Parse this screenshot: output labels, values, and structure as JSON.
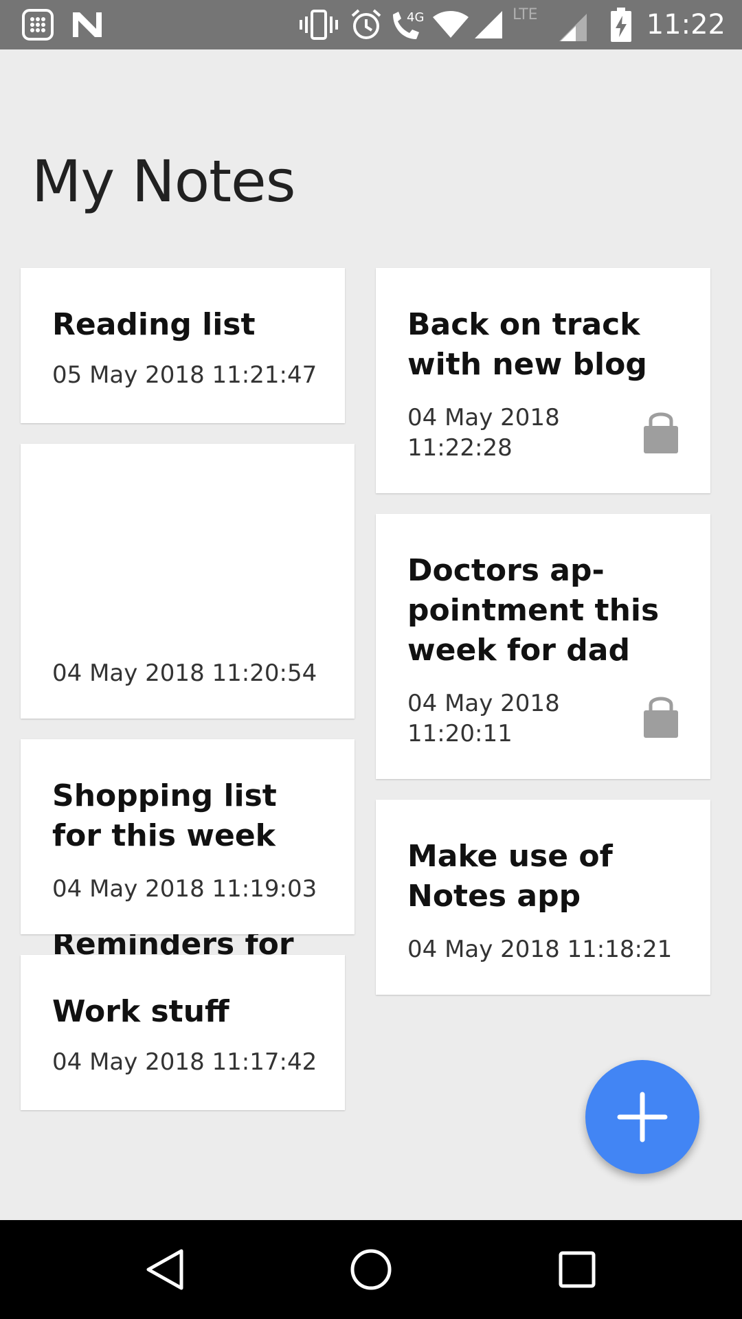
{
  "statusbar": {
    "time": "11:22",
    "network_label": "4G",
    "lte_label": "LTE",
    "icons": [
      "launcher-icon",
      "n-icon",
      "vibrate-icon",
      "alarm-icon",
      "wifi-calling-icon",
      "wifi-icon",
      "signal-icon",
      "lte-signal-icon",
      "battery-charging-icon"
    ]
  },
  "page": {
    "title": "My Notes"
  },
  "notes": [
    {
      "title": "Reading list",
      "date": "05 May 2018 11:21:47",
      "locked": false
    },
    {
      "title": "Back on track\nwith new blog",
      "date": "04 May 2018\n11:22:28",
      "locked": true
    },
    {
      "title": "Reminders for\nthis week. Need\nto start packing\nfor trip",
      "date": "04 May 2018 11:20:54",
      "locked": false
    },
    {
      "title": "Doctors ap-\npointment this\nweek for dad",
      "date": "04 May 2018\n11:20:11",
      "locked": true
    },
    {
      "title": "Shopping list\nfor this week",
      "date": "04 May 2018 11:19:03",
      "locked": false
    },
    {
      "title": "Make use of\nNotes app",
      "date": "04 May 2018 11:18:21",
      "locked": false
    },
    {
      "title": "Work stuff",
      "date": "04 May 2018 11:17:42",
      "locked": false
    }
  ],
  "fab": {
    "icon": "plus-icon",
    "color": "#4285f4"
  },
  "navbar": {
    "icons": [
      "back-icon",
      "home-icon",
      "recents-icon"
    ]
  },
  "colors": {
    "background": "#ececec",
    "statusbar": "#757575",
    "lock": "#9e9e9e"
  }
}
